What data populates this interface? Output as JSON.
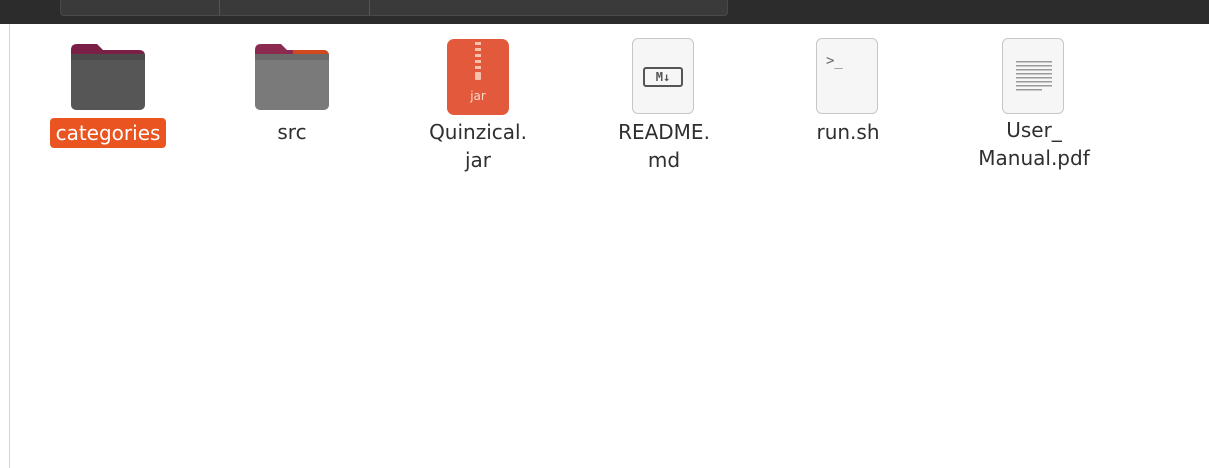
{
  "files": [
    {
      "name": "categories",
      "type": "folder",
      "selected": true
    },
    {
      "name": "src",
      "type": "folder",
      "selected": false
    },
    {
      "name": "Quinzical.\njar",
      "type": "jar",
      "selected": false,
      "icon_text": "jar"
    },
    {
      "name": "README.\nmd",
      "type": "markdown",
      "selected": false,
      "icon_text": "M↓"
    },
    {
      "name": "run.sh",
      "type": "shell",
      "selected": false,
      "icon_text": ">_"
    },
    {
      "name": "User_\nManual.pdf",
      "type": "pdf",
      "selected": false
    }
  ],
  "colors": {
    "selection": "#e95420",
    "folder_tab": "#7a1f45",
    "jar": "#e2593b"
  }
}
